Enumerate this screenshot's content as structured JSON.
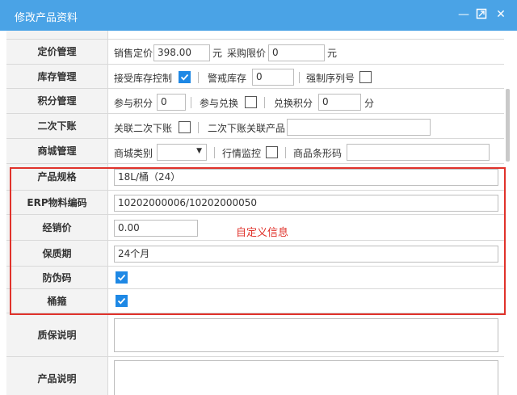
{
  "window": {
    "title": "修改产品资料"
  },
  "pricing": {
    "label": "定价管理",
    "sale_price_label": "销售定价",
    "sale_price": "398.00",
    "sale_unit": "元",
    "purchase_limit_label": "采购限价",
    "purchase_limit": "0",
    "purchase_unit": "元"
  },
  "inventory": {
    "label": "库存管理",
    "accept_stock_label": "接受库存控制",
    "accept_stock": true,
    "alert_stock_label": "警戒库存",
    "alert_stock": "0",
    "serial_label": "强制序列号",
    "serial": false
  },
  "points": {
    "label": "积分管理",
    "participate_label": "参与积分",
    "participate_value": "0",
    "exchange_label": "参与兑换",
    "exchange": false,
    "redeem_label": "兑换积分",
    "redeem_value": "0",
    "redeem_unit": "分"
  },
  "secondary": {
    "label": "二次下账",
    "link_label": "关联二次下账",
    "link": false,
    "product_label": "二次下账关联产品",
    "product_value": ""
  },
  "mall": {
    "label": "商城管理",
    "category_label": "商城类别",
    "category_value": "",
    "monitor_label": "行情监控",
    "monitor": false,
    "barcode_label": "商品条形码",
    "barcode_value": ""
  },
  "custom": {
    "note": "自定义信息",
    "spec_label": "产品规格",
    "spec_value": "18L/桶（24）",
    "erp_label": "ERP物料编码",
    "erp_value": "10202000006/10202000050",
    "dealer_label": "经销价",
    "dealer_value": "0.00",
    "shelf_label": "保质期",
    "shelf_value": "24个月",
    "anti_label": "防伪码",
    "anti": true,
    "bucket_label": "桶箍",
    "bucket": true
  },
  "warranty": {
    "label": "质保说明",
    "value": ""
  },
  "description": {
    "label": "产品说明",
    "value": ""
  },
  "colors": {
    "titlebar": "#4aa3e6",
    "highlight": "#e0322b",
    "checkbox": "#1e88e5"
  }
}
